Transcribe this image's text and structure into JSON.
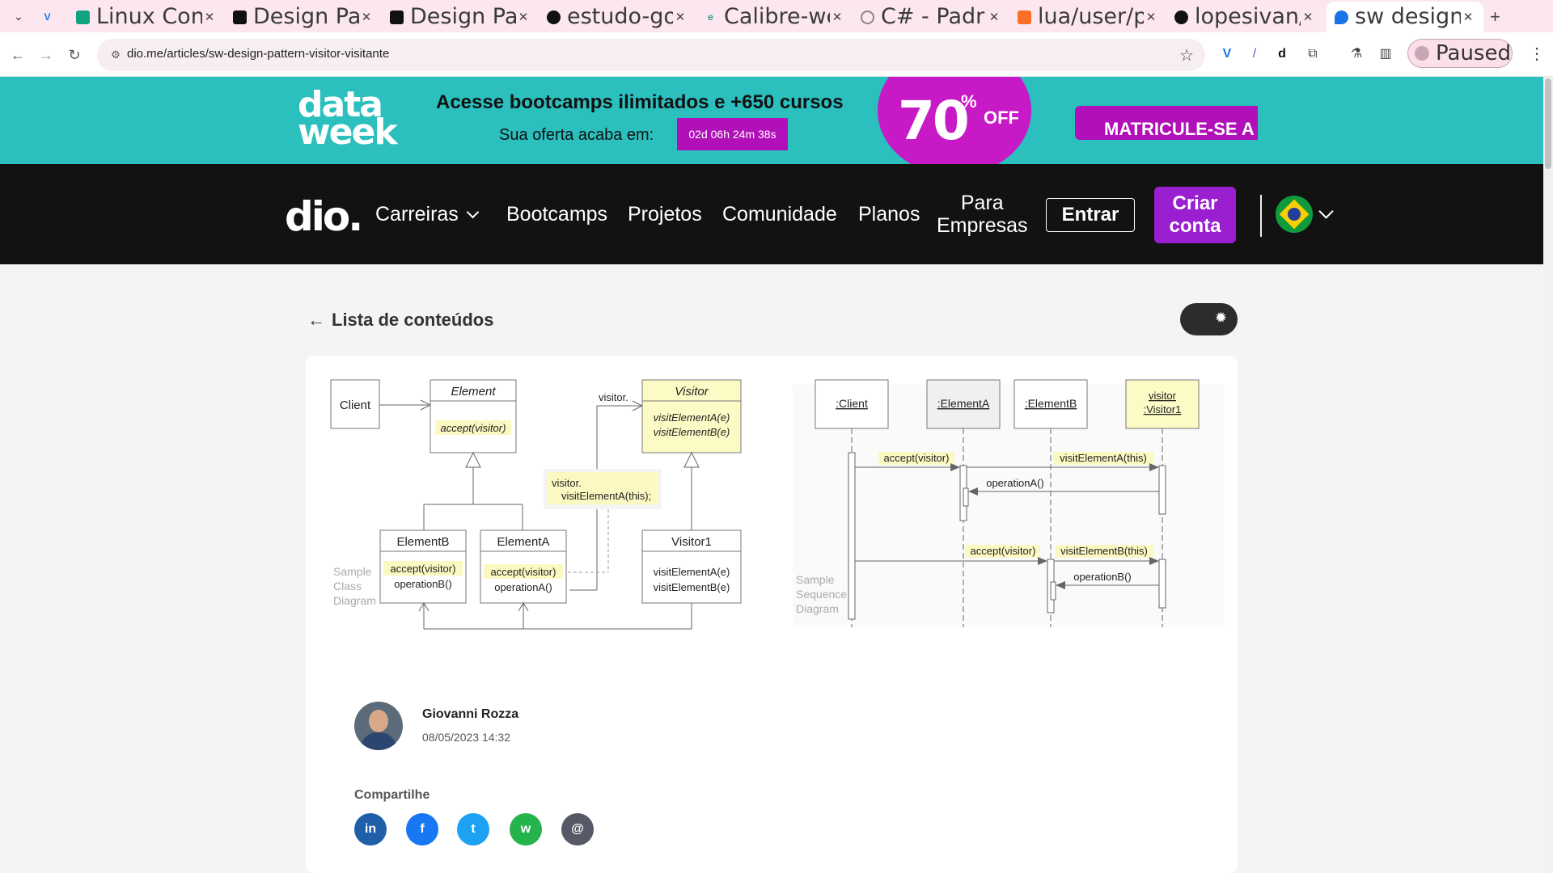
{
  "browser": {
    "tabs": [
      {
        "title": "",
        "icon": "vimeo-icon",
        "color": "#1a73e8"
      },
      {
        "title": "Linux Con",
        "icon": "openai-icon",
        "color": "#10a37f"
      },
      {
        "title": "Design Pa",
        "icon": "dio-icon",
        "color": "#111111"
      },
      {
        "title": "Design Pa",
        "icon": "dio-icon",
        "color": "#111111"
      },
      {
        "title": "estudo-go",
        "icon": "github-icon",
        "color": "#111111"
      },
      {
        "title": "Calibre-we",
        "icon": "calibre-icon",
        "color": "#2a9d8f"
      },
      {
        "title": "C# -  Padr",
        "icon": "loading-icon",
        "color": "#888888"
      },
      {
        "title": "lua/user/p",
        "icon": "gitlab-icon",
        "color": "#fc6d26"
      },
      {
        "title": "lopesivan/",
        "icon": "github-icon",
        "color": "#111111"
      },
      {
        "title": "sw design",
        "icon": "dio-drop-icon",
        "color": "#1a73e8"
      }
    ],
    "url": "dio.me/articles/sw-design-pattern-visitor-visitante",
    "profile_label": "Paused"
  },
  "promo": {
    "logo_line1": "data",
    "logo_line2": "week",
    "title": "Acesse bootcamps ilimitados e +650 cursos",
    "subtitle": "Sua oferta acaba em:",
    "countdown": "02d 06h 24m 38s",
    "discount_number": "70",
    "discount_percent": "%",
    "discount_word": "OFF",
    "cta": "MATRICULE-SE A",
    "colors": {
      "background": "#2bbfbe",
      "accent": "#b10fb8"
    }
  },
  "nav": {
    "logo": "dio.",
    "carreiras": "Carreiras",
    "bootcamps": "Bootcamps",
    "projetos": "Projetos",
    "comunidade": "Comunidade",
    "planos": "Planos",
    "empresas_line1": "Para",
    "empresas_line2": "Empresas",
    "entrar": "Entrar",
    "criar_line1": "Criar",
    "criar_line2": "conta"
  },
  "content": {
    "back_label": "Lista de conteúdos",
    "theme_toggle_icon": "sun-icon"
  },
  "diagram": {
    "class_diagram": {
      "client": "Client",
      "element": "Element",
      "element_method": "accept(visitor)",
      "visitor": "Visitor",
      "visitor_method_a": "visitElementA(e)",
      "visitor_method_b": "visitElementB(e)",
      "visitor_arrow_label": "visitor.",
      "note_line1": "visitor.",
      "note_line2": "visitElementA(this);",
      "element_b": "ElementB",
      "element_b_m1": "accept(visitor)",
      "element_b_m2": "operationB()",
      "element_a": "ElementA",
      "element_a_m1": "accept(visitor)",
      "element_a_m2": "operationA()",
      "visitor1": "Visitor1",
      "visitor1_m1": "visitElementA(e)",
      "visitor1_m2": "visitElementB(e)",
      "caption_1": "Sample",
      "caption_2": "Class",
      "caption_3": "Diagram"
    },
    "sequence_diagram": {
      "client": ":Client",
      "element_a": ":ElementA",
      "element_b": ":ElementB",
      "visitor_l1": "visitor",
      "visitor_l2": ":Visitor1",
      "msg1": "accept(visitor)",
      "msg2": "visitElementA(this)",
      "msg3": "operationA()",
      "msg4": "accept(visitor)",
      "msg5": "visitElementB(this)",
      "msg6": "operationB()",
      "caption_1": "Sample",
      "caption_2": "Sequence",
      "caption_3": "Diagram"
    }
  },
  "author": {
    "name": "Giovanni Rozza",
    "date": "08/05/2023 14:32"
  },
  "share": {
    "label": "Compartilhe",
    "linkedin": "in",
    "facebook": "f",
    "twitter": "t",
    "whatsapp": "w",
    "email": "@"
  }
}
